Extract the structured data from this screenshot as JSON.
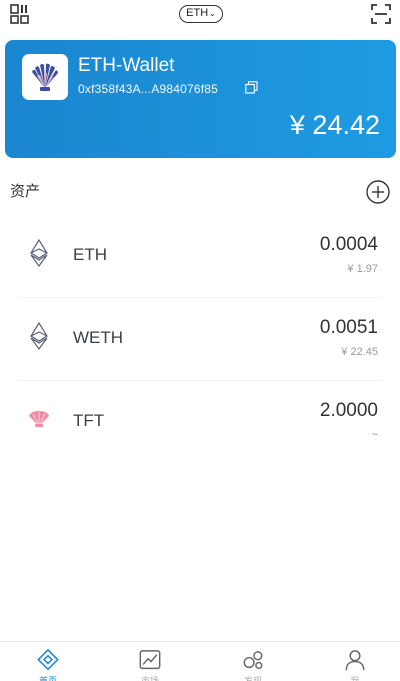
{
  "header": {
    "network": "ETH",
    "qr_icon": "qr-code-icon",
    "scan_icon": "scan-icon"
  },
  "wallet": {
    "name": "ETH-Wallet",
    "address": "0xf358f43A...A984076f85",
    "balance": "¥ 24.42",
    "accent_color": "#1a86cf"
  },
  "assets": {
    "title": "资产",
    "items": [
      {
        "symbol": "ETH",
        "amount": "0.0004",
        "value": "¥ 1.97",
        "icon": "ethereum-icon"
      },
      {
        "symbol": "WETH",
        "amount": "0.0051",
        "value": "¥ 22.45",
        "icon": "ethereum-icon"
      },
      {
        "symbol": "TFT",
        "amount": "2.0000",
        "value": "~",
        "icon": "tft-token-icon"
      }
    ]
  },
  "tabbar": {
    "tabs": [
      {
        "label": "首页",
        "icon": "wallet-home-icon",
        "active": true
      },
      {
        "label": "市场",
        "icon": "chart-icon",
        "active": false
      },
      {
        "label": "发现",
        "icon": "discover-icon",
        "active": false
      },
      {
        "label": "我",
        "icon": "user-icon",
        "active": false
      }
    ]
  }
}
